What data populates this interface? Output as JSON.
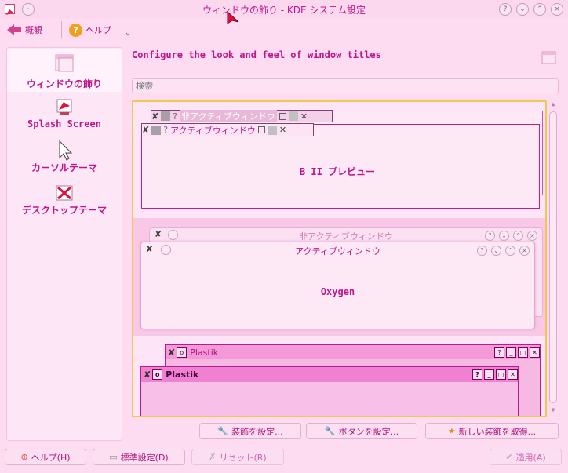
{
  "window": {
    "title": "ウィンドウの飾り - KDE システム設定"
  },
  "toolbar": {
    "overview": "概観",
    "help": "ヘルプ"
  },
  "sidebar": {
    "items": [
      {
        "label": "ウィンドウの飾り",
        "icon": "window-decoration-icon"
      },
      {
        "label": "Splash Screen",
        "icon": "splash-screen-icon"
      },
      {
        "label": "カーソルテーマ",
        "icon": "cursor-icon"
      },
      {
        "label": "デスクトップテーマ",
        "icon": "desktop-theme-icon"
      }
    ]
  },
  "main": {
    "heading": "Configure the look and feel of window titles",
    "search_placeholder": "検索",
    "decorations": [
      {
        "name": "B II プレビュー",
        "inactive_title": "非アクティブウィンドウ",
        "active_title": "アクティブウィンドウ"
      },
      {
        "name": "Oxygen",
        "inactive_title": "非アクティブウィンドウ",
        "active_title": "アクティブウィンドウ"
      },
      {
        "name": "",
        "inactive_title": "Plastik",
        "active_title": "Plastik"
      }
    ],
    "buttons": {
      "configure_decoration": "装飾を設定...",
      "configure_buttons": "ボタンを設定...",
      "get_new": "新しい装飾を取得..."
    }
  },
  "footer": {
    "help": "ヘルプ(H)",
    "defaults": "標準設定(D)",
    "reset": "リセット(R)",
    "apply": "適用(A)"
  },
  "colors": {
    "accent": "#c0148c",
    "background": "#fddcf2",
    "selection_border": "#f0c84c"
  }
}
